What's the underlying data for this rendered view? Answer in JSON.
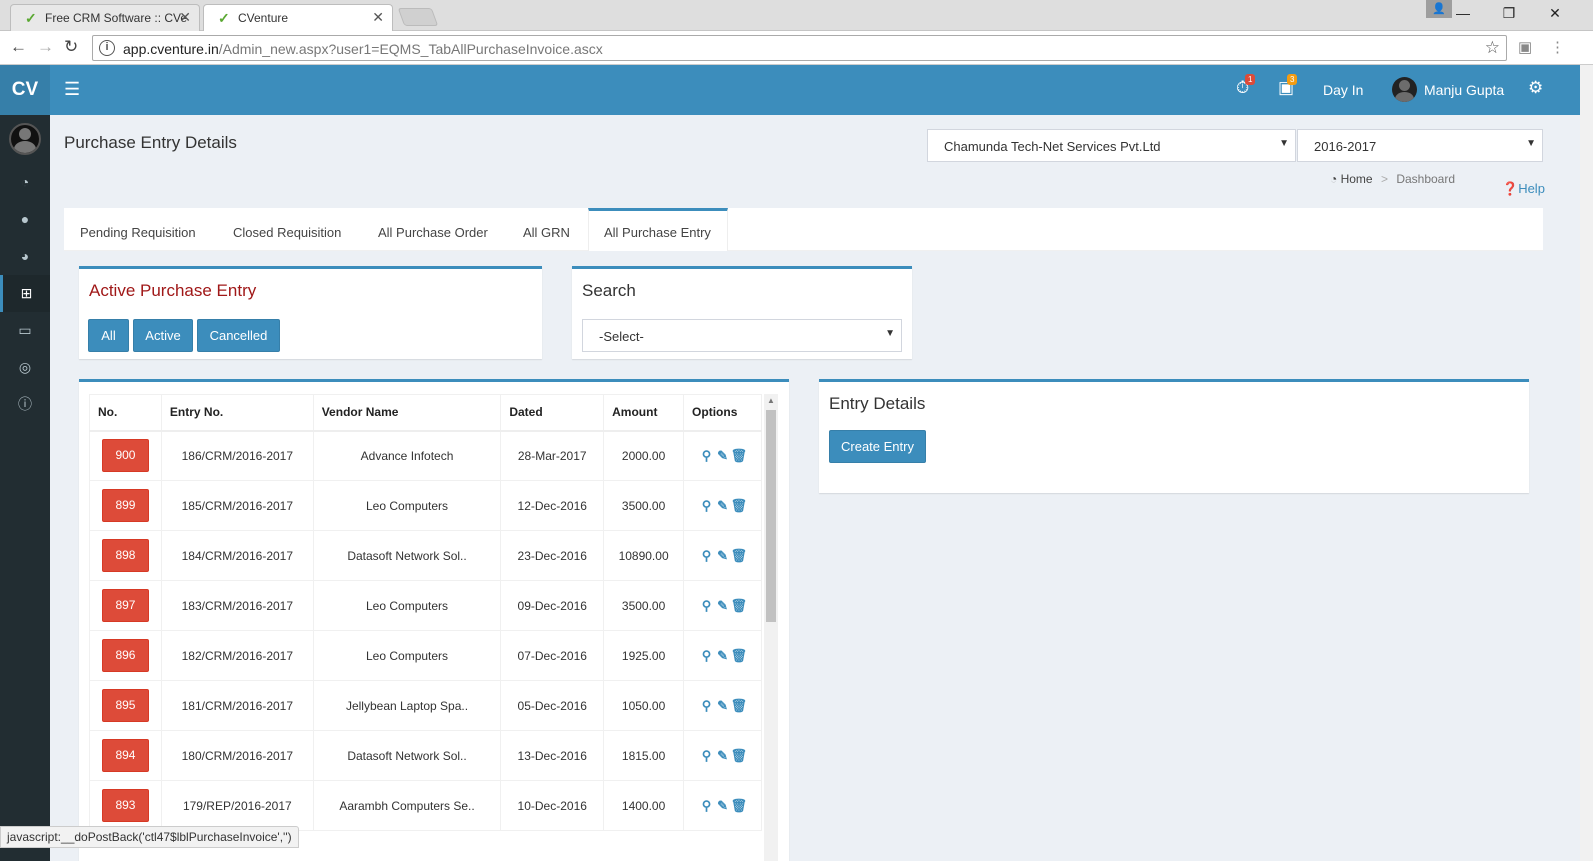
{
  "browser": {
    "tabs": [
      {
        "title": "Free CRM Software :: CVe"
      },
      {
        "title": "CVenture"
      }
    ],
    "url_host": "app.cventure.in",
    "url_path": "/Admin_new.aspx?user1=EQMS_TabAllPurchaseInvoice.ascx",
    "status": "javascript:__doPostBack('ctl47$lblPurchaseInvoice','')"
  },
  "header": {
    "logo": "CV",
    "badge_alerts": "1",
    "badge_messages": "3",
    "day_in": "Day In",
    "user_name": "Manju Gupta"
  },
  "page": {
    "title": "Purchase Entry Details",
    "company": "Chamunda Tech-Net Services Pvt.Ltd",
    "year": "2016-2017",
    "breadcrumb_home": "Home",
    "breadcrumb_sep": ">",
    "breadcrumb_current": "Dashboard",
    "help": "Help"
  },
  "tabs": [
    {
      "label": "Pending Requisition"
    },
    {
      "label": "Closed Requisition"
    },
    {
      "label": "All Purchase Order"
    },
    {
      "label": "All GRN"
    },
    {
      "label": "All Purchase Entry"
    }
  ],
  "active_box": {
    "title": "Active Purchase Entry",
    "buttons": [
      "All",
      "Active",
      "Cancelled"
    ]
  },
  "search_box": {
    "title": "Search",
    "select_value": "-Select-"
  },
  "table": {
    "headers": [
      "No.",
      "Entry No.",
      "Vendor Name",
      "Dated",
      "Amount",
      "Options"
    ],
    "rows": [
      {
        "no": "900",
        "entry": "186/CRM/2016-2017",
        "vendor": "Advance Infotech",
        "dated": "28-Mar-2017",
        "amount": "2000.00"
      },
      {
        "no": "899",
        "entry": "185/CRM/2016-2017",
        "vendor": "Leo Computers",
        "dated": "12-Dec-2016",
        "amount": "3500.00"
      },
      {
        "no": "898",
        "entry": "184/CRM/2016-2017",
        "vendor": "Datasoft Network Sol..",
        "dated": "23-Dec-2016",
        "amount": "10890.00"
      },
      {
        "no": "897",
        "entry": "183/CRM/2016-2017",
        "vendor": "Leo Computers",
        "dated": "09-Dec-2016",
        "amount": "3500.00"
      },
      {
        "no": "896",
        "entry": "182/CRM/2016-2017",
        "vendor": "Leo Computers",
        "dated": "07-Dec-2016",
        "amount": "1925.00"
      },
      {
        "no": "895",
        "entry": "181/CRM/2016-2017",
        "vendor": "Jellybean Laptop Spa..",
        "dated": "05-Dec-2016",
        "amount": "1050.00"
      },
      {
        "no": "894",
        "entry": "180/CRM/2016-2017",
        "vendor": "Datasoft Network Sol..",
        "dated": "13-Dec-2016",
        "amount": "1815.00"
      },
      {
        "no": "893",
        "entry": "179/REP/2016-2017",
        "vendor": "Aarambh Computers Se..",
        "dated": "10-Dec-2016",
        "amount": "1400.00"
      }
    ]
  },
  "entry_details": {
    "title": "Entry Details",
    "create_button": "Create Entry"
  },
  "colors": {
    "primary": "#3c8dbc",
    "danger": "#dd4b39",
    "sidebar": "#222d32"
  }
}
